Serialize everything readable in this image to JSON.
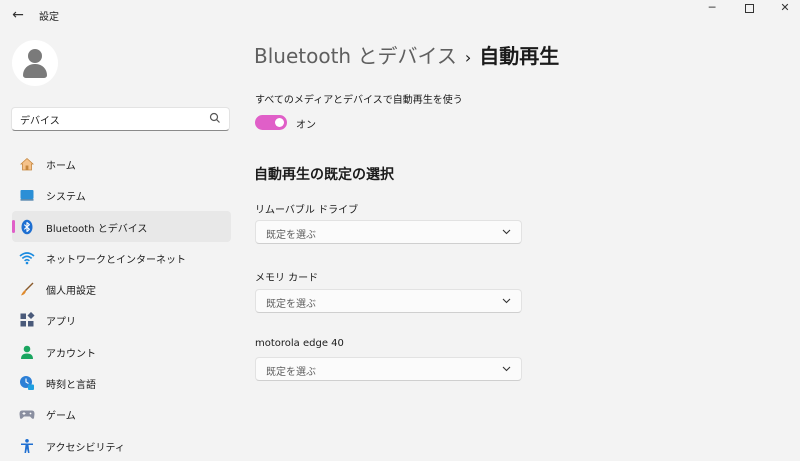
{
  "window": {
    "title": "設定",
    "back_glyph": "←",
    "minimize_glyph": "─",
    "close_glyph": "✕"
  },
  "search": {
    "value": "デバイス"
  },
  "sidebar": {
    "items": [
      {
        "label": "ホーム",
        "icon": "home-icon",
        "selected": false
      },
      {
        "label": "システム",
        "icon": "system-icon",
        "selected": false
      },
      {
        "label": "Bluetooth とデバイス",
        "icon": "bluetooth-icon",
        "selected": true
      },
      {
        "label": "ネットワークとインターネット",
        "icon": "network-icon",
        "selected": false
      },
      {
        "label": "個人用設定",
        "icon": "personalization-icon",
        "selected": false
      },
      {
        "label": "アプリ",
        "icon": "apps-icon",
        "selected": false
      },
      {
        "label": "アカウント",
        "icon": "accounts-icon",
        "selected": false
      },
      {
        "label": "時刻と言語",
        "icon": "time-language-icon",
        "selected": false
      },
      {
        "label": "ゲーム",
        "icon": "gaming-icon",
        "selected": false
      },
      {
        "label": "アクセシビリティ",
        "icon": "accessibility-icon",
        "selected": false
      }
    ]
  },
  "breadcrumb": {
    "parent": "Bluetooth とデバイス",
    "separator": "›",
    "current": "自動再生"
  },
  "autoplay_toggle": {
    "description": "すべてのメディアとデバイスで自動再生を使う",
    "state_label": "オン",
    "on": true
  },
  "defaults": {
    "section_title": "自動再生の既定の選択",
    "items": [
      {
        "label": "リムーバブル ドライブ",
        "value": "既定を選ぶ"
      },
      {
        "label": "メモリ カード",
        "value": "既定を選ぶ"
      },
      {
        "label": "motorola edge 40",
        "value": "既定を選ぶ"
      }
    ]
  },
  "colors": {
    "accent": "#e05fc8",
    "background": "#f3f3f3"
  }
}
